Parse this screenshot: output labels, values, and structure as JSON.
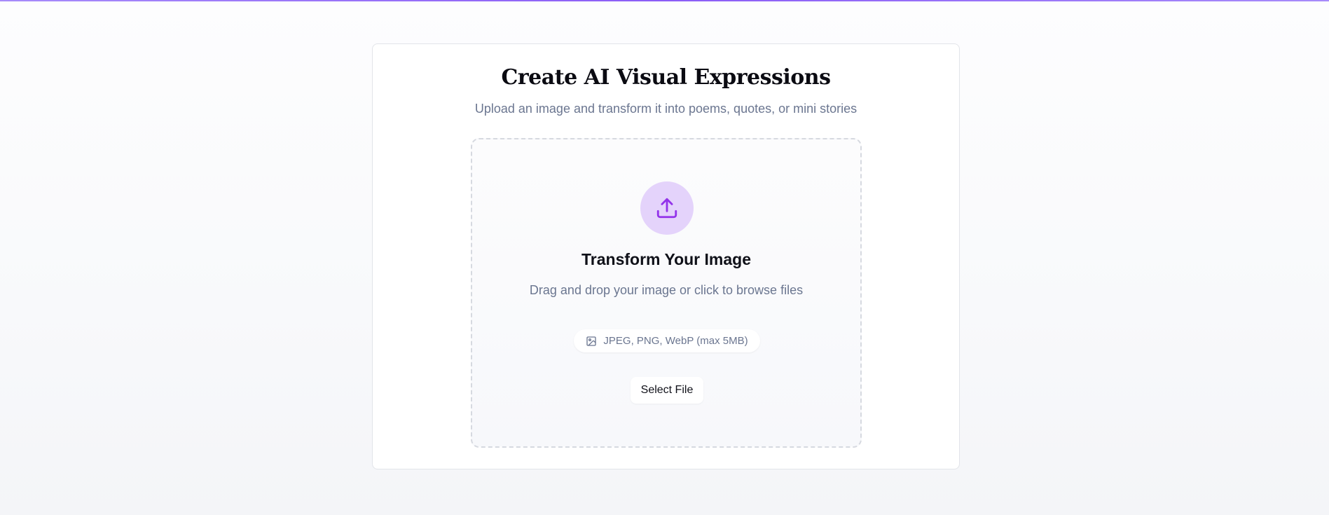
{
  "header": {
    "title": "Create AI Visual Expressions",
    "subtitle": "Upload an image and transform it into poems, quotes, or mini stories"
  },
  "dropzone": {
    "icon": "upload-icon",
    "title": "Transform Your Image",
    "description": "Drag and drop your image or click to browse files",
    "formats_icon": "image-icon",
    "formats": "JPEG, PNG, WebP (max 5MB)",
    "button_label": "Select File"
  },
  "colors": {
    "accent": "#8b5cf6",
    "upload_circle": "#e4d3fb",
    "muted_text": "#6b7690"
  }
}
